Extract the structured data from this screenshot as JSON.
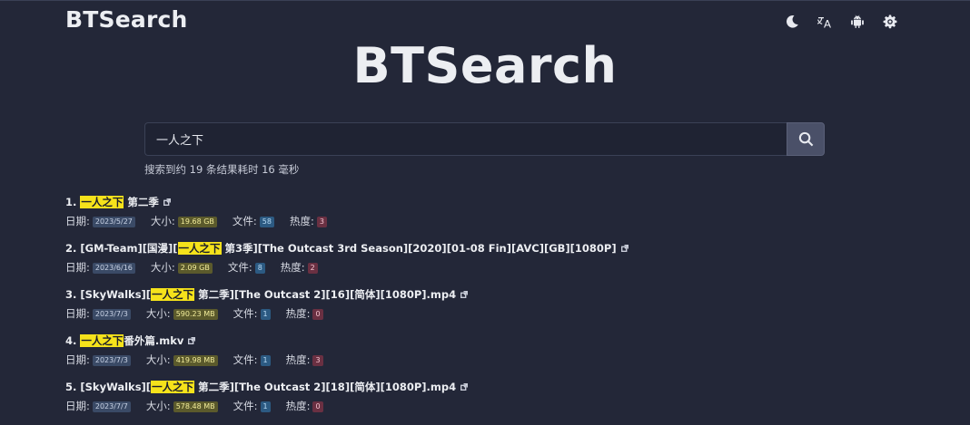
{
  "brand": "BTSearch",
  "hero_title": "BTSearch",
  "header_icons": [
    "moon-icon",
    "translate-icon",
    "android-icon",
    "gear-icon"
  ],
  "search": {
    "value": "一人之下",
    "placeholder": ""
  },
  "stats_text": "搜索到约 19 条结果耗时 16 毫秒",
  "labels": {
    "date": "日期:",
    "size": "大小:",
    "files": "文件:",
    "heat": "热度:"
  },
  "colors": {
    "background": "#232738",
    "highlight": "#f5e21b"
  },
  "results": [
    {
      "index": "1.",
      "pre": "",
      "hl": "一人之下",
      "post": " 第二季",
      "date": "2023/5/27",
      "size": "19.68 GB",
      "files": "58",
      "heat": "3"
    },
    {
      "index": "2.",
      "pre": "[GM-Team][国漫][",
      "hl": "一人之下",
      "post": " 第3季][The Outcast 3rd Season][2020][01-08 Fin][AVC][GB][1080P]",
      "date": "2023/6/16",
      "size": "2.09 GB",
      "files": "8",
      "heat": "2"
    },
    {
      "index": "3.",
      "pre": "[SkyWalks][",
      "hl": "一人之下",
      "post": " 第二季][The Outcast 2][16][简体][1080P].mp4",
      "date": "2023/7/3",
      "size": "590.23 MB",
      "files": "1",
      "heat": "0"
    },
    {
      "index": "4.",
      "pre": "",
      "hl": "一人之下",
      "post": "番外篇.mkv",
      "date": "2023/7/3",
      "size": "419.98 MB",
      "files": "1",
      "heat": "3"
    },
    {
      "index": "5.",
      "pre": "[SkyWalks][",
      "hl": "一人之下",
      "post": " 第二季][The Outcast 2][18][简体][1080P].mp4",
      "date": "2023/7/7",
      "size": "578.48 MB",
      "files": "1",
      "heat": "0"
    }
  ]
}
